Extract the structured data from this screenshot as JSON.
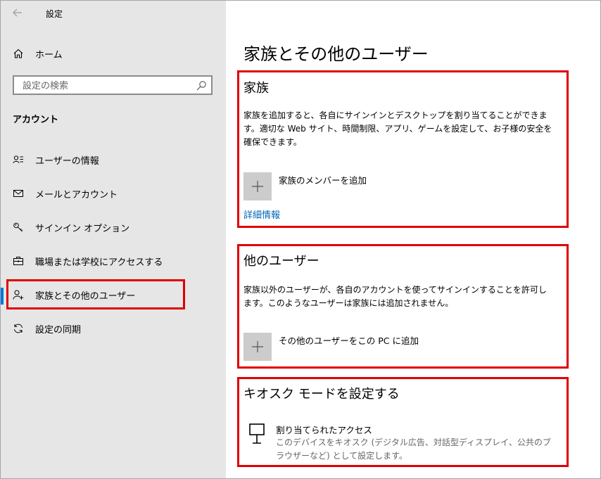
{
  "app": {
    "title": "設定"
  },
  "sidebar": {
    "home_label": "ホーム",
    "search_placeholder": "設定の検索",
    "section_label": "アカウント",
    "items": [
      {
        "label": "ユーザーの情報",
        "icon": "user-info-icon"
      },
      {
        "label": "メールとアカウント",
        "icon": "mail-icon"
      },
      {
        "label": "サインイン オプション",
        "icon": "key-icon"
      },
      {
        "label": "職場または学校にアクセスする",
        "icon": "briefcase-icon"
      },
      {
        "label": "家族とその他のユーザー",
        "icon": "person-add-icon",
        "active": true
      },
      {
        "label": "設定の同期",
        "icon": "sync-icon"
      }
    ]
  },
  "main": {
    "page_title": "家族とその他のユーザー",
    "family": {
      "title": "家族",
      "description": "家族を追加すると、各自にサインインとデスクトップを割り当てることができます。適切な Web サイト、時間制限、アプリ、ゲームを設定して、お子様の安全を確保できます。",
      "add_label": "家族のメンバーを追加",
      "more_info": "詳細情報"
    },
    "other_users": {
      "title": "他のユーザー",
      "description": "家族以外のユーザーが、各自のアカウントを使ってサインインすることを許可します。このようなユーザーは家族には追加されません。",
      "add_label": "その他のユーザーをこの PC に追加"
    },
    "kiosk": {
      "title": "キオスク モードを設定する",
      "item_title": "割り当てられたアクセス",
      "item_desc": "このデバイスをキオスク (デジタル広告、対話型ディスプレイ、公共のブラウザーなど) として設定します。"
    }
  },
  "colors": {
    "accent": "#0078d7",
    "highlight": "#e00000",
    "link": "#0067b8",
    "sidebar_bg": "#e6e6e6"
  }
}
